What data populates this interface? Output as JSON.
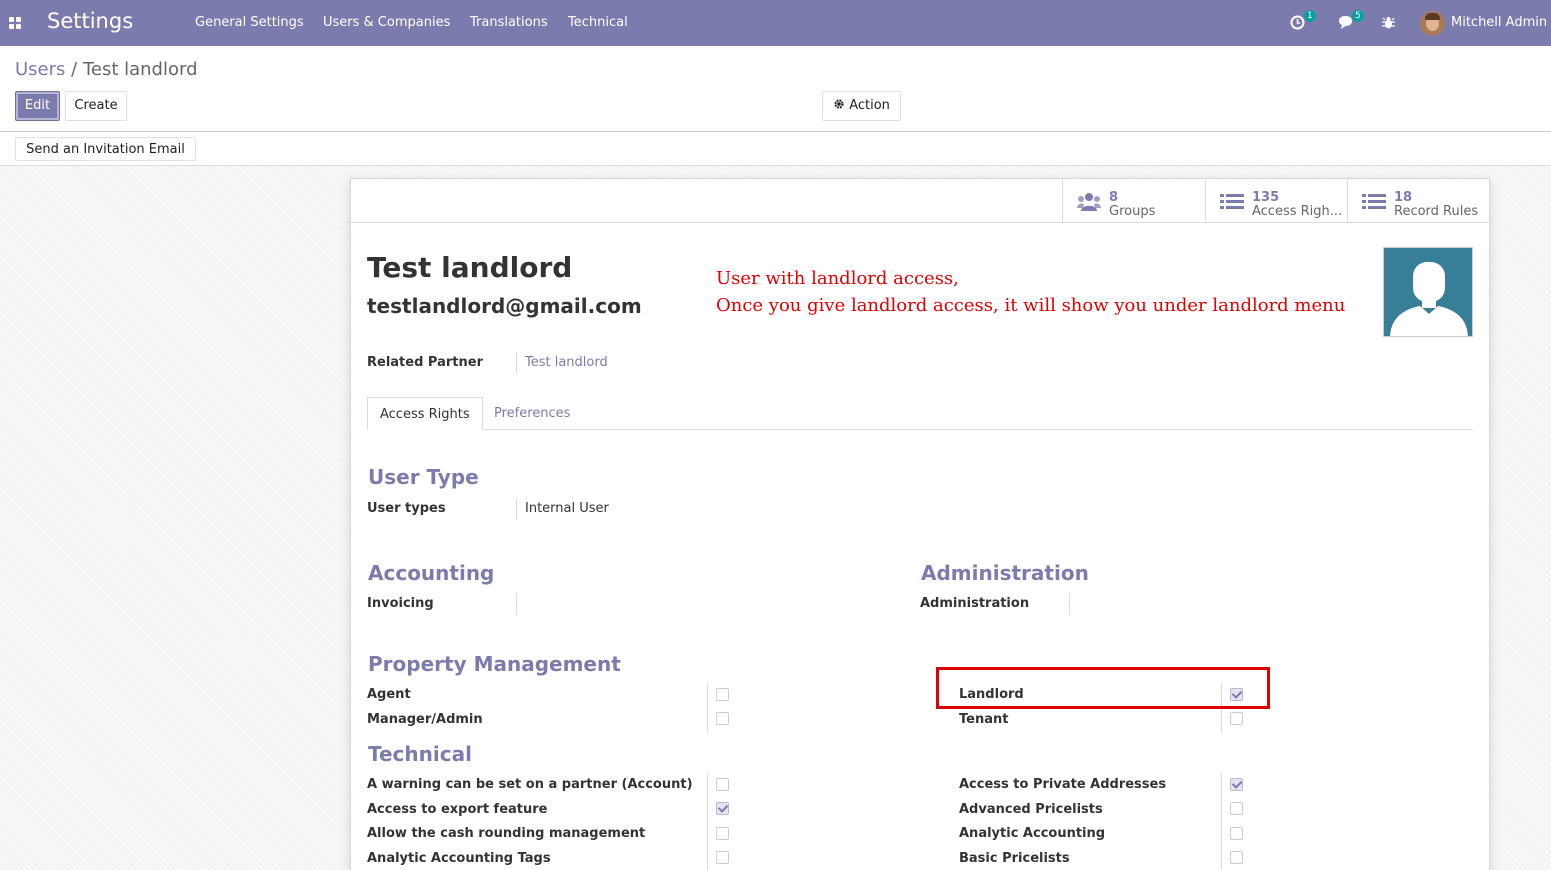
{
  "navbar": {
    "app_title": "Settings",
    "menus": [
      "General Settings",
      "Users & Companies",
      "Translations",
      "Technical"
    ],
    "activity_count": "1",
    "messages_count": "5",
    "user_name": "Mitchell Admin",
    "brand_color": "#7c7bad",
    "badge_color": "#00a09d"
  },
  "breadcrumb": {
    "parent": "Users",
    "separator": "/",
    "current": "Test landlord"
  },
  "toolbar": {
    "edit": "Edit",
    "create": "Create",
    "action": "Action",
    "invite": "Send an Invitation Email"
  },
  "smart_buttons": [
    {
      "value": "8",
      "label": "Groups",
      "icon": "users-icon"
    },
    {
      "value": "135",
      "label": "Access Righ...",
      "icon": "list-icon"
    },
    {
      "value": "18",
      "label": "Record Rules",
      "icon": "list-icon"
    }
  ],
  "user": {
    "name": "Test landlord",
    "email": "testlandlord@gmail.com"
  },
  "annotation": {
    "line1": "User with landlord access,",
    "line2": "Once you give landlord access, it will show you under landlord menu",
    "color": "#e00000"
  },
  "related_partner": {
    "label": "Related Partner",
    "value": "Test landlord"
  },
  "tabs": [
    "Access Rights",
    "Preferences"
  ],
  "user_type": {
    "title": "User Type",
    "label": "User types",
    "value": "Internal User"
  },
  "accounting": {
    "title": "Accounting",
    "label": "Invoicing",
    "value": ""
  },
  "administration": {
    "title": "Administration",
    "label": "Administration",
    "value": ""
  },
  "property_management": {
    "title": "Property Management",
    "items": [
      {
        "label": "Agent",
        "checked": false
      },
      {
        "label": "Manager/Admin",
        "checked": false
      },
      {
        "label": "Landlord",
        "checked": true
      },
      {
        "label": "Tenant",
        "checked": false
      }
    ]
  },
  "technical": {
    "title": "Technical",
    "items": [
      {
        "label": "A warning can be set on a partner (Account)",
        "checked": false
      },
      {
        "label": "Access to export feature",
        "checked": true
      },
      {
        "label": "Allow the cash rounding management",
        "checked": false
      },
      {
        "label": "Analytic Accounting Tags",
        "checked": false
      },
      {
        "label": "Access to Private Addresses",
        "checked": true
      },
      {
        "label": "Advanced Pricelists",
        "checked": false
      },
      {
        "label": "Analytic Accounting",
        "checked": false
      },
      {
        "label": "Basic Pricelists",
        "checked": false
      }
    ]
  }
}
